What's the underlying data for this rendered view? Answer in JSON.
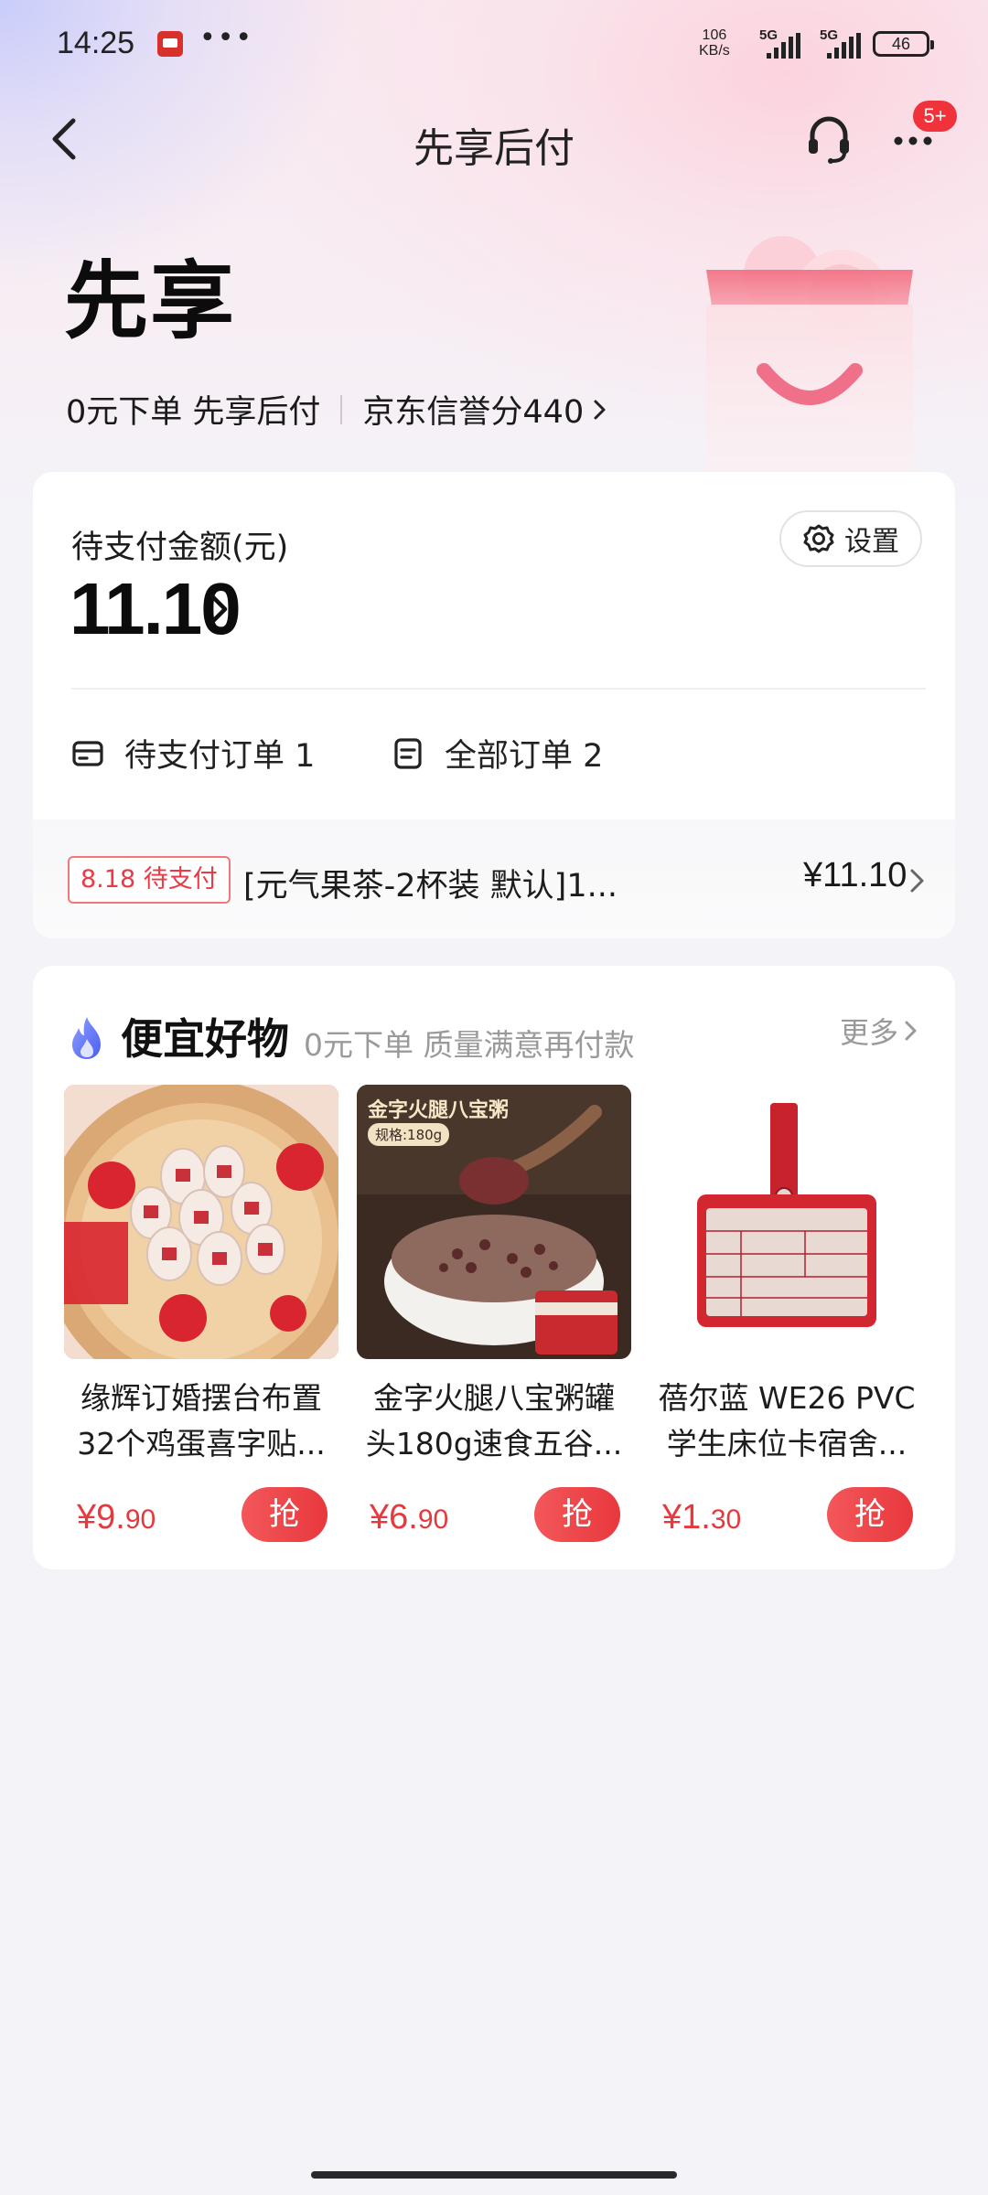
{
  "status_bar": {
    "time": "14:25",
    "more": "•••",
    "net_speed_value": "106",
    "net_speed_unit": "KB/s",
    "sim1": "5G",
    "sim2": "5G",
    "battery": "46"
  },
  "nav": {
    "title": "先享后付",
    "badge": "5+"
  },
  "hero": {
    "brand": "先享",
    "tagline": "0元下单 先享后付",
    "credit_text": "京东信誉分440"
  },
  "pay_card": {
    "label": "待支付金额(元)",
    "amount": "11.10",
    "settings_label": "设置",
    "pending_orders": "待支付订单 1",
    "all_orders": "全部订单 2",
    "pending_item": {
      "tag": "8.18 待支付",
      "title": "[元气果茶-2杯装 默认]1...",
      "price": "¥11.10"
    }
  },
  "goods": {
    "title": "便宜好物",
    "subtitle": "0元下单 质量满意再付款",
    "more": "更多",
    "buy_label": "抢",
    "products": [
      {
        "name_line1": "缘辉订婚摆台布置",
        "name_line2": "32个鸡蛋喜字贴...",
        "price_int": "¥9.",
        "price_dec": "90",
        "image_text": ""
      },
      {
        "name_line1": "金字火腿八宝粥罐",
        "name_line2": "头180g速食五谷...",
        "price_int": "¥6.",
        "price_dec": "90",
        "image_text": "金字火腿八宝粥",
        "image_spec": "规格:180g"
      },
      {
        "name_line1": "蓓尔蓝 WE26 PVC",
        "name_line2": "学生床位卡宿舍...",
        "price_int": "¥1.",
        "price_dec": "30",
        "image_text": ""
      }
    ]
  },
  "colors": {
    "accent_red": "#e8383d",
    "badge_red": "#f0323a"
  }
}
